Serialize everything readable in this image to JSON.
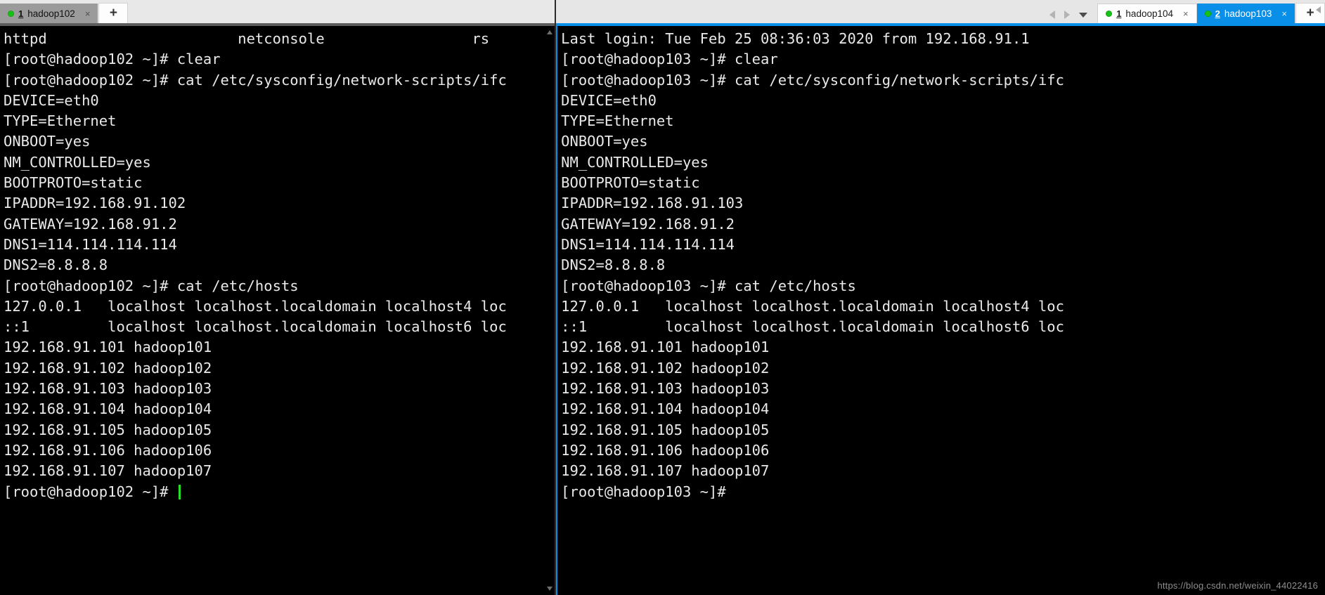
{
  "left_window": {
    "tabs": [
      {
        "index": "1",
        "label": "hadoop102",
        "state": "active-grey",
        "status_icon": "green-dot-icon",
        "close_icon": "×"
      }
    ],
    "new_tab_label": "+",
    "terminal": {
      "prompt_user_host": "[root@hadoop102 ~]#",
      "lines": [
        "httpd                      netconsole                 rs",
        "[root@hadoop102 ~]# clear",
        "[root@hadoop102 ~]# cat /etc/sysconfig/network-scripts/ifc",
        "DEVICE=eth0",
        "TYPE=Ethernet",
        "ONBOOT=yes",
        "NM_CONTROLLED=yes",
        "BOOTPROTO=static",
        "IPADDR=192.168.91.102",
        "GATEWAY=192.168.91.2",
        "DNS1=114.114.114.114",
        "DNS2=8.8.8.8",
        "[root@hadoop102 ~]# cat /etc/hosts",
        "127.0.0.1   localhost localhost.localdomain localhost4 loc",
        "::1         localhost localhost.localdomain localhost6 loc",
        "192.168.91.101 hadoop101",
        "192.168.91.102 hadoop102",
        "192.168.91.103 hadoop103",
        "192.168.91.104 hadoop104",
        "192.168.91.105 hadoop105",
        "192.168.91.106 hadoop106",
        "192.168.91.107 hadoop107"
      ],
      "last_prompt": "[root@hadoop102 ~]# ",
      "cursor_visible": true
    },
    "scrollbar": {
      "up_icon": "triangle-up-icon",
      "down_icon": "triangle-down-icon"
    }
  },
  "right_window": {
    "nav": {
      "prev_icon": "triangle-left-icon",
      "next_icon": "triangle-right-icon",
      "menu_icon": "caret-down-icon",
      "collapse_icon": "triangle-left-icon"
    },
    "tabs": [
      {
        "index": "1",
        "label": "hadoop104",
        "state": "inactive",
        "status_icon": "green-dot-icon",
        "close_icon": "×"
      },
      {
        "index": "2",
        "label": "hadoop103",
        "state": "active",
        "status_icon": "green-dot-icon",
        "close_icon": "×"
      }
    ],
    "new_tab_label": "+",
    "terminal": {
      "prompt_user_host": "[root@hadoop103 ~]#",
      "lines": [
        "Last login: Tue Feb 25 08:36:03 2020 from 192.168.91.1",
        "[root@hadoop103 ~]# clear",
        "[root@hadoop103 ~]# cat /etc/sysconfig/network-scripts/ifc",
        "DEVICE=eth0",
        "TYPE=Ethernet",
        "ONBOOT=yes",
        "NM_CONTROLLED=yes",
        "BOOTPROTO=static",
        "IPADDR=192.168.91.103",
        "GATEWAY=192.168.91.2",
        "DNS1=114.114.114.114",
        "DNS2=8.8.8.8",
        "[root@hadoop103 ~]# cat /etc/hosts",
        "127.0.0.1   localhost localhost.localdomain localhost4 loc",
        "::1         localhost localhost.localdomain localhost6 loc",
        "192.168.91.101 hadoop101",
        "192.168.91.102 hadoop102",
        "192.168.91.103 hadoop103",
        "192.168.91.104 hadoop104",
        "192.168.91.105 hadoop105",
        "192.168.91.106 hadoop106",
        "192.168.91.107 hadoop107"
      ],
      "last_prompt": "[root@hadoop103 ~]#",
      "cursor_visible": false
    }
  },
  "watermark": "https://blog.csdn.net/weixin_44022416",
  "colors": {
    "terminal_bg": "#000000",
    "terminal_fg": "#e9e9e9",
    "accent_blue": "#0a8fe8",
    "tab_active_grey": "#9b9b9b",
    "status_green": "#16c216",
    "cursor_green": "#26e026",
    "strip_bg": "#e8e8e8"
  }
}
